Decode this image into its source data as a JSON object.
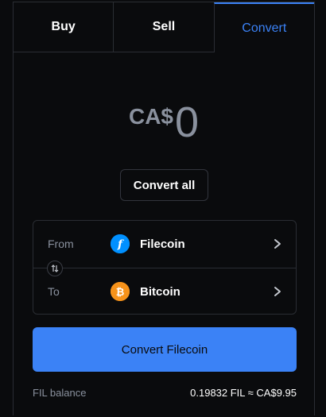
{
  "tabs": [
    {
      "label": "Buy",
      "active": false
    },
    {
      "label": "Sell",
      "active": false
    },
    {
      "label": "Convert",
      "active": true
    }
  ],
  "amount": {
    "currency": "CA$",
    "value": "0"
  },
  "convert_all_label": "Convert all",
  "from": {
    "label": "From",
    "asset": "Filecoin",
    "icon": "filecoin-icon",
    "color": "#0090ff"
  },
  "to": {
    "label": "To",
    "asset": "Bitcoin",
    "icon": "bitcoin-icon",
    "color": "#f7931a"
  },
  "primary_button_label": "Convert Filecoin",
  "balance": {
    "label": "FIL balance",
    "value": "0.19832 FIL ≈ CA$9.95"
  },
  "colors": {
    "accent": "#3b82f6",
    "background": "#0a0b0d",
    "muted_text": "#8a919e",
    "border": "#2a2d33"
  }
}
